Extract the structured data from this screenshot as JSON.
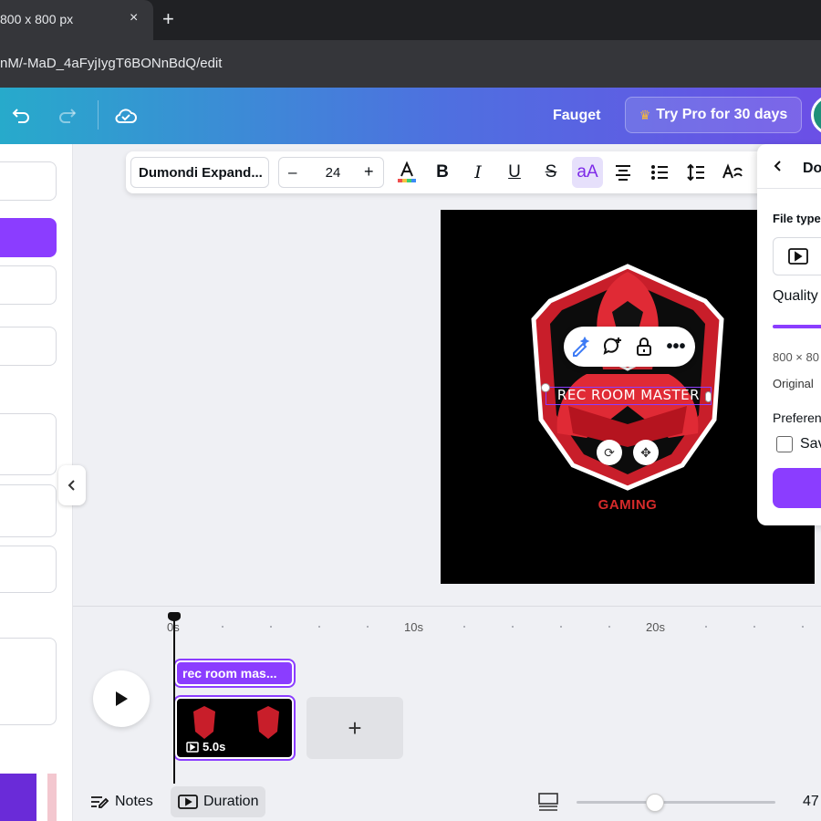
{
  "browser": {
    "tab_title": "800 x 800 px",
    "tab_close": "×",
    "new_tab": "+",
    "url": "nM/-MaD_4aFyjIygT6BONnBdQ/edit"
  },
  "header": {
    "user_name": "Fauget",
    "try_pro": "Try Pro for 30 days"
  },
  "toolbar": {
    "font_name": "Dumondi Expand...",
    "font_size": "24",
    "minus": "–",
    "plus": "+",
    "bold": "B",
    "italic": "I",
    "underline": "U",
    "strikethrough": "S",
    "case": "aA"
  },
  "canvas": {
    "selected_text": "REC ROOM MASTER",
    "subtitle": "GAMING"
  },
  "download_panel": {
    "title": "Do",
    "file_type_label": "File type",
    "quality_label": "Quality",
    "dimensions": "800 × 80",
    "original": "Original",
    "preferences_label": "Preferen",
    "save_label": "Sav"
  },
  "timeline": {
    "ticks": [
      "0s",
      "10s",
      "20s"
    ],
    "text_track": "rec room mas...",
    "video_duration": "5.0s",
    "add": "+",
    "notes": "Notes",
    "duration": "Duration",
    "zoom": "47"
  },
  "colors": {
    "accent": "#8b3dff",
    "logo_red": "#d62a2a",
    "header_start": "#27aacb",
    "header_end": "#6b4fe6"
  }
}
